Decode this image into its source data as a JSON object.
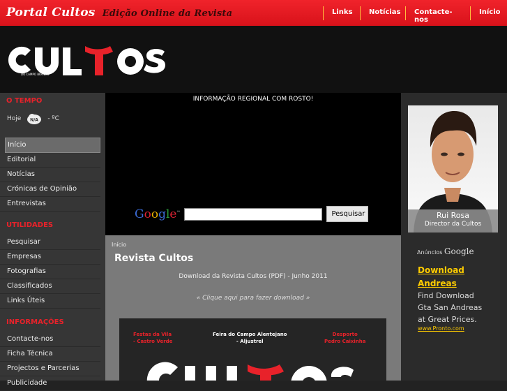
{
  "header": {
    "brand": "Portal Cultos",
    "tagline": "Edição Online da Revista",
    "nav": [
      "Links",
      "Notícias",
      "Contacte-nos",
      "Início"
    ],
    "logo_text": "CULTOS",
    "logo_sub": "DO CAMPO BRANCO"
  },
  "sidebar": {
    "weather_title": "O TEMPO",
    "weather_day": "Hoje",
    "weather_icon_text": "N/A",
    "weather_temp": "- ºC",
    "menu": [
      "Início",
      "Editorial",
      "Notícias",
      "Crónicas de Opinião",
      "Entrevistas"
    ],
    "util_title": "UTILIDADES",
    "util": [
      "Pesquisar",
      "Empresas",
      "Fotografias",
      "Classificados",
      "Links Úteis"
    ],
    "info_title": "INFORMAÇÕES",
    "info": [
      "Contacte-nos",
      "Ficha Técnica",
      "Projectos e Parcerias",
      "Publicidade"
    ]
  },
  "main": {
    "slogan": "INFORMAÇÃO REGIONAL COM ROSTO!",
    "search_button": "Pesquisar",
    "search_value": "",
    "google_tm": "™",
    "breadcrumb": "Início",
    "title": "Revista Cultos",
    "download_text": "Download da Revista Cultos (PDF) - Junho 2011",
    "download_link": "« Clique aqui para fazer download »",
    "cover_left": "Festas da Vila\n- Castro Verde",
    "cover_mid": "Feira do Campo Alentejano\n- Aljustrel",
    "cover_right": "Desporto\nPedro Caixinha",
    "cover_logo": "CULTOS"
  },
  "aside": {
    "photo_name": "Rui Rosa",
    "photo_role": "Director da Cultos",
    "ads_label": "Anúncios",
    "ad_title": "Download Andreas",
    "ad_body": "Find Download Gta San Andreas at Great Prices.",
    "ad_url": "www.Pronto.com"
  },
  "colors": {
    "accent_red": "#e8222a",
    "ad_yellow": "#ffcc00"
  }
}
